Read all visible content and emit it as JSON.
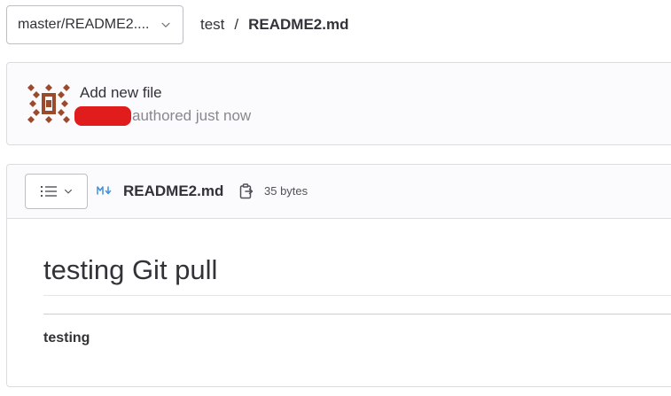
{
  "branch_selector": {
    "label": "master/README2...."
  },
  "breadcrumb": {
    "project": "test",
    "separator": "/",
    "current_file": "README2.md"
  },
  "commit": {
    "title": "Add new file",
    "meta": "authored just now"
  },
  "file": {
    "type_icon": "markdown-icon",
    "name": "README2.md",
    "size": "35 bytes"
  },
  "readme": {
    "heading": "testing Git pull",
    "paragraph": "testing"
  },
  "colors": {
    "redaction": "#e01c1c",
    "avatar": "#9b4a2c",
    "markdown_icon": "#428fdc"
  }
}
